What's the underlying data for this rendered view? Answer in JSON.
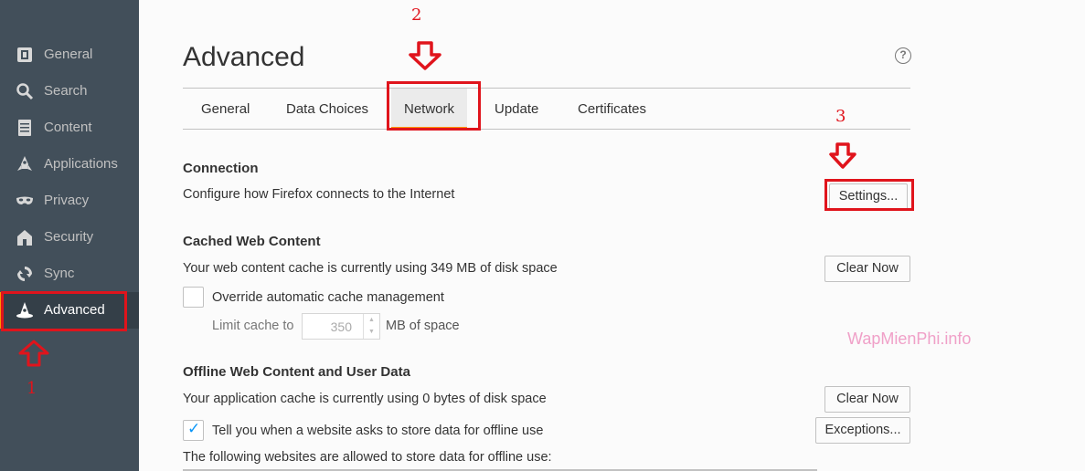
{
  "sidebar": {
    "items": [
      {
        "id": "general",
        "label": "General",
        "icon": "general-icon"
      },
      {
        "id": "search",
        "label": "Search",
        "icon": "search-icon"
      },
      {
        "id": "content",
        "label": "Content",
        "icon": "content-icon"
      },
      {
        "id": "applications",
        "label": "Applications",
        "icon": "applications-icon"
      },
      {
        "id": "privacy",
        "label": "Privacy",
        "icon": "mask-icon"
      },
      {
        "id": "security",
        "label": "Security",
        "icon": "security-icon"
      },
      {
        "id": "sync",
        "label": "Sync",
        "icon": "sync-icon"
      },
      {
        "id": "advanced",
        "label": "Advanced",
        "icon": "wizard-hat-icon",
        "selected": true
      }
    ]
  },
  "page": {
    "title": "Advanced",
    "help_glyph": "?"
  },
  "tabs": [
    {
      "label": "General"
    },
    {
      "label": "Data Choices"
    },
    {
      "label": "Network",
      "selected": true
    },
    {
      "label": "Update"
    },
    {
      "label": "Certificates"
    }
  ],
  "connection": {
    "title": "Connection",
    "description": "Configure how Firefox connects to the Internet",
    "settings_button": "Settings..."
  },
  "cache": {
    "title": "Cached Web Content",
    "status": "Your web content cache is currently using 349 MB of disk space",
    "clear_button": "Clear Now",
    "override_label": "Override automatic cache management",
    "override_checked": false,
    "limit_label": "Limit cache to",
    "limit_value": "350",
    "limit_unit": "MB of space"
  },
  "offline": {
    "title": "Offline Web Content and User Data",
    "status": "Your application cache is currently using 0 bytes of disk space",
    "clear_button": "Clear Now",
    "tell_label": "Tell you when a website asks to store data for offline use",
    "tell_checked": true,
    "exceptions_button": "Exceptions...",
    "allowed_label": "The following websites are allowed to store data for offline use:"
  },
  "annotations": {
    "step1": "1",
    "step2": "2",
    "step3": "3"
  },
  "watermark": "WapMienPhi.info",
  "colors": {
    "sidebar_bg": "#424f5a",
    "sidebar_selected": "#343f48",
    "accent": "#ff9500",
    "annotation_red": "#e0141c",
    "checkbox_blue": "#0996f8"
  }
}
